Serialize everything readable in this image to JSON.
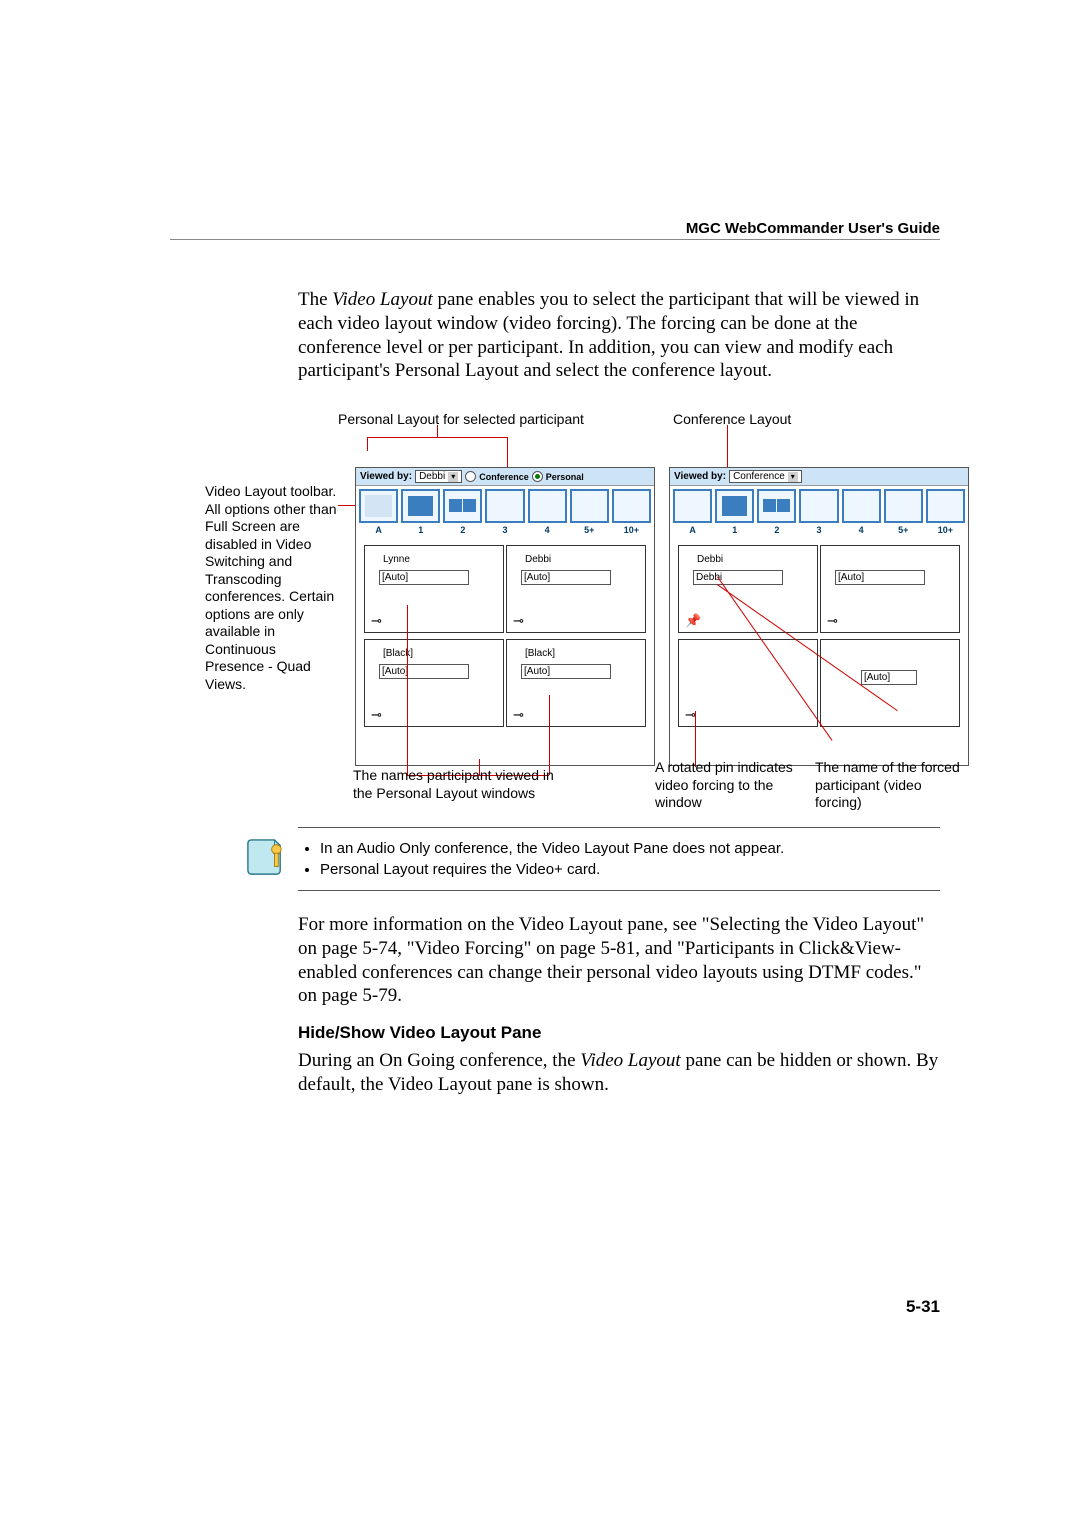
{
  "header": {
    "title": "MGC WebCommander User's Guide"
  },
  "intro": "The Video Layout pane enables you to select the participant that will be viewed in each video layout window (video forcing). The forcing can be done at the conference level or per participant. In addition, you can view and modify each participant's Personal Layout and select the conference layout.",
  "italic_phrase": "Video Layout",
  "labels": {
    "personal_top": "Personal Layout for selected participant",
    "conference_top": "Conference Layout",
    "side": "Video Layout toolbar. All options other than Full Screen are disabled in Video Switching and Transcoding conferences. Certain options are only available in Continuous Presence - Quad Views.",
    "bottom_left": "The names participant viewed in the Personal Layout windows",
    "bottom_mid": "A rotated pin indicates video forcing to the window",
    "bottom_right": "The name of the forced participant (video forcing)"
  },
  "toolbar": {
    "viewed_by": "Viewed by:",
    "left_select": "Debbi",
    "right_select": "Conference",
    "conference_label": "Conference",
    "personal_label": "Personal",
    "nums": [
      "A",
      "1",
      "2",
      "3",
      "4",
      "5+",
      "10+"
    ]
  },
  "cells": {
    "l_tl_name": "Lynne",
    "l_tl_box": "[Auto]",
    "l_tr_name": "Debbi",
    "l_tr_box": "[Auto]",
    "l_bl_name": "[Black]",
    "l_bl_box": "[Auto]",
    "l_br_name": "[Black]",
    "l_br_box": "[Auto]",
    "r_tl_name": "Debbi",
    "r_tl_box": "Debbi",
    "r_tr_box": "[Auto]",
    "r_bl_box": "[Auto]"
  },
  "note": {
    "item1": "In an Audio Only conference, the Video Layout Pane does not appear.",
    "item2": "Personal Layout requires the Video+ card."
  },
  "after_note": "For more information on the Video Layout pane, see \"Selecting the Video Layout\" on page 5-74, \"Video Forcing\" on page 5-81, and \"Participants in Click&View-enabled conferences can change their personal video layouts using DTMF codes.\" on page 5-79.",
  "subhead": "Hide/Show Video Layout Pane",
  "sub_body_1": "During an On Going conference, the ",
  "sub_body_italic": "Video Layout",
  "sub_body_2": " pane can be hidden or shown. By default, the Video Layout pane is shown.",
  "page_number": "5-31"
}
